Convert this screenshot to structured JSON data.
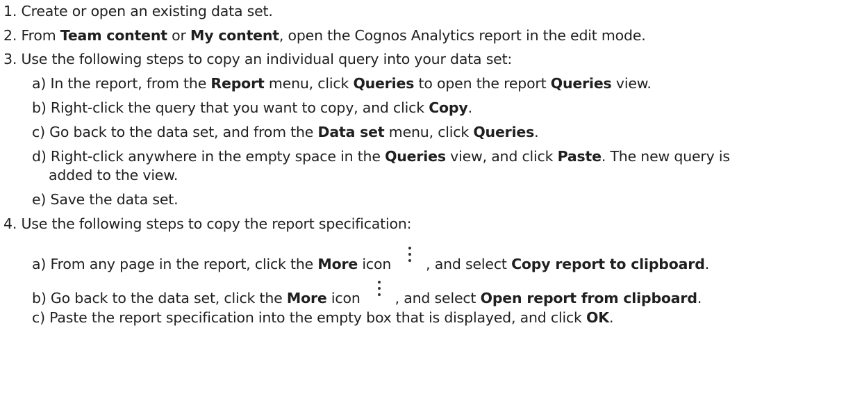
{
  "steps": {
    "s1": {
      "text": "1. Create or open an existing data set."
    },
    "s2": {
      "pre": "2. From ",
      "b1": "Team content",
      "mid": " or ",
      "b2": "My content",
      "post": ", open the Cognos Analytics report in the edit mode."
    },
    "s3": {
      "text": "3. Use the following steps to copy an individual query into your data set:"
    },
    "s3a": {
      "pre": "a) In the report, from the ",
      "b1": "Report",
      "mid1": " menu, click ",
      "b2": "Queries",
      "mid2": " to open the report ",
      "b3": "Queries",
      "post": " view."
    },
    "s3b": {
      "pre": "b) Right-click the query that you want to copy, and click ",
      "b1": "Copy",
      "post": "."
    },
    "s3c": {
      "pre": "c) Go back to the data set, and from the ",
      "b1": "Data set",
      "mid": " menu, click ",
      "b2": "Queries",
      "post": "."
    },
    "s3d": {
      "pre": "d) Right-click anywhere in the empty space in the ",
      "b1": "Queries",
      "mid": " view, and click ",
      "b2": "Paste",
      "post": ". The new query is",
      "cont": "added to the view."
    },
    "s3e": {
      "text": "e) Save the data set."
    },
    "s4": {
      "text": "4. Use the following steps to copy the report specification:"
    },
    "s4a": {
      "pre": "a) From any page in the report, click the ",
      "b1": "More",
      "mid": " icon",
      "post": ", and select ",
      "b2": "Copy report to clipboard",
      "end": "."
    },
    "s4b": {
      "pre": "b) Go back to the data set, click the ",
      "b1": "More",
      "mid": " icon",
      "post": ", and select ",
      "b2": "Open report from clipboard",
      "end": "."
    },
    "s4c": {
      "pre": "c) Paste the report specification into the empty box that is displayed, and click ",
      "b1": "OK",
      "post": "."
    }
  }
}
